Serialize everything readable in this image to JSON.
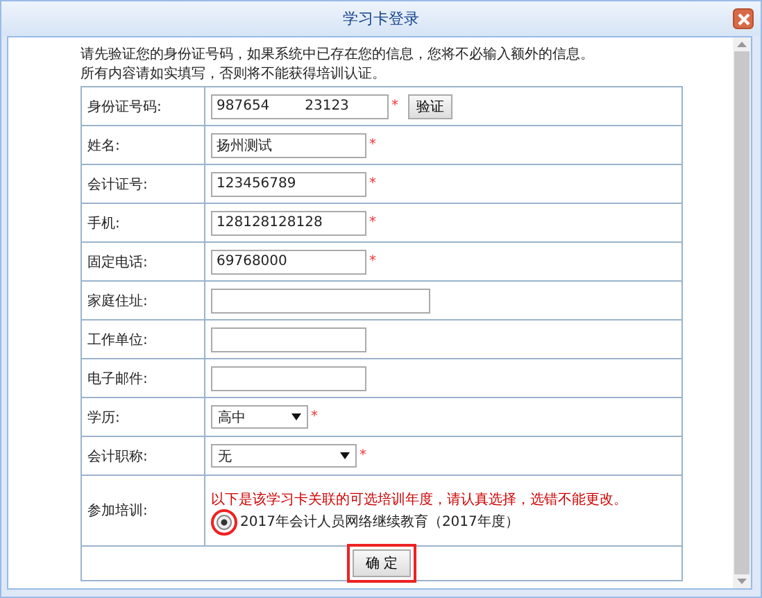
{
  "window": {
    "title": "学习卡登录"
  },
  "intro": [
    "请先验证您的身份证号码，如果系统中已存在您的信息，您将不必输入额外的信息。",
    "所有内容请如实填写，否则将不能获得培训认证。"
  ],
  "fields": [
    {
      "kind": "id",
      "label": "身份证号码:",
      "value": "987654        23123",
      "required_mark": "*",
      "button": "验证"
    },
    {
      "kind": "text",
      "label": "姓名:",
      "value": "扬州测试",
      "required_mark": "*"
    },
    {
      "kind": "text",
      "label": "会计证号:",
      "value": "123456789",
      "required_mark": "*"
    },
    {
      "kind": "text",
      "label": "手机:",
      "value": "128128128128",
      "required_mark": "*"
    },
    {
      "kind": "text",
      "label": "固定电话:",
      "value": "69768000",
      "required_mark": "*"
    },
    {
      "kind": "wide",
      "label": "家庭住址:"
    },
    {
      "kind": "text",
      "label": "工作单位:"
    },
    {
      "kind": "text",
      "label": "电子邮件:"
    },
    {
      "kind": "select",
      "label": "学历:",
      "value": "高中",
      "required_mark": "*"
    },
    {
      "kind": "select-wide",
      "label": "会计职称:",
      "value": "无",
      "required_mark": "*"
    }
  ],
  "training": {
    "label": "参加培训:",
    "notice": "以下是该学习卡关联的可选培训年度，请认真选择，选错不能更改。",
    "options": [
      {
        "label": "2017年会计人员网络继续教育（2017年度）",
        "selected": true
      }
    ]
  },
  "submit": "确 定"
}
